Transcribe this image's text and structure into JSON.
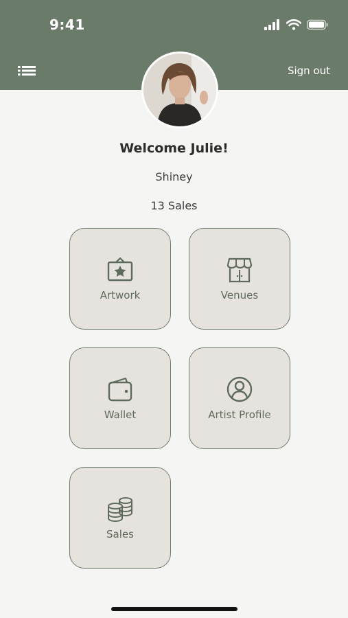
{
  "status_bar": {
    "time": "9:41"
  },
  "header": {
    "signout_label": "Sign out",
    "menu_icon": "menu-list-icon"
  },
  "profile": {
    "welcome": "Welcome Julie!",
    "name": "Shiney",
    "sales": "13 Sales"
  },
  "tiles": [
    {
      "label": "Artwork",
      "icon": "framed-star-icon"
    },
    {
      "label": "Venues",
      "icon": "storefront-icon"
    },
    {
      "label": "Wallet",
      "icon": "wallet-icon"
    },
    {
      "label": "Artist Profile",
      "icon": "user-circle-icon"
    },
    {
      "label": "Sales",
      "icon": "coins-stack-icon"
    }
  ],
  "colors": {
    "header_bg": "#6b7b69",
    "tile_bg": "#e6e2de",
    "tile_border": "#6f7a6e",
    "page_bg": "#f5f5f4"
  }
}
